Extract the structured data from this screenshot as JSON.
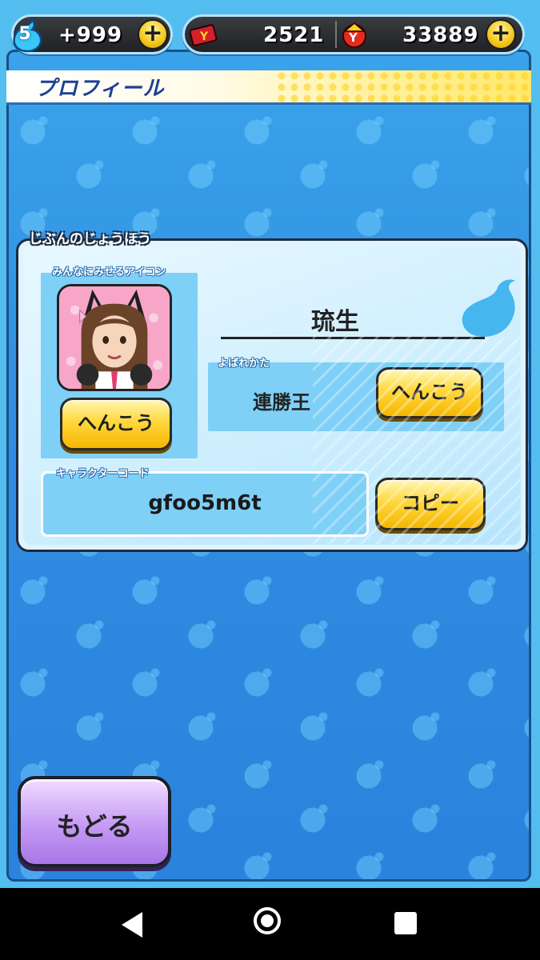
{
  "status_bar": {
    "level": "5",
    "stamina": "+999",
    "tickets": "2521",
    "coins": "33889",
    "plus_label": "+"
  },
  "header": {
    "title": "プロフィール"
  },
  "profile": {
    "section_title": "じぶんのじょうほう",
    "icon_label": "みんなにみせるアイコン",
    "icon_change_button": "へんこう",
    "player_name": "琉生",
    "title_label": "よばれかた",
    "title_value": "連勝王",
    "title_change_button": "へんこう",
    "code_label": "キャラクターコード",
    "code_value": "gfoo5m6t",
    "copy_button": "コピー"
  },
  "back_button": "もどる",
  "colors": {
    "accent_yellow": "#ffd83c",
    "back_purple": "#c59af5",
    "panel_blue": "#7ed0f7"
  }
}
